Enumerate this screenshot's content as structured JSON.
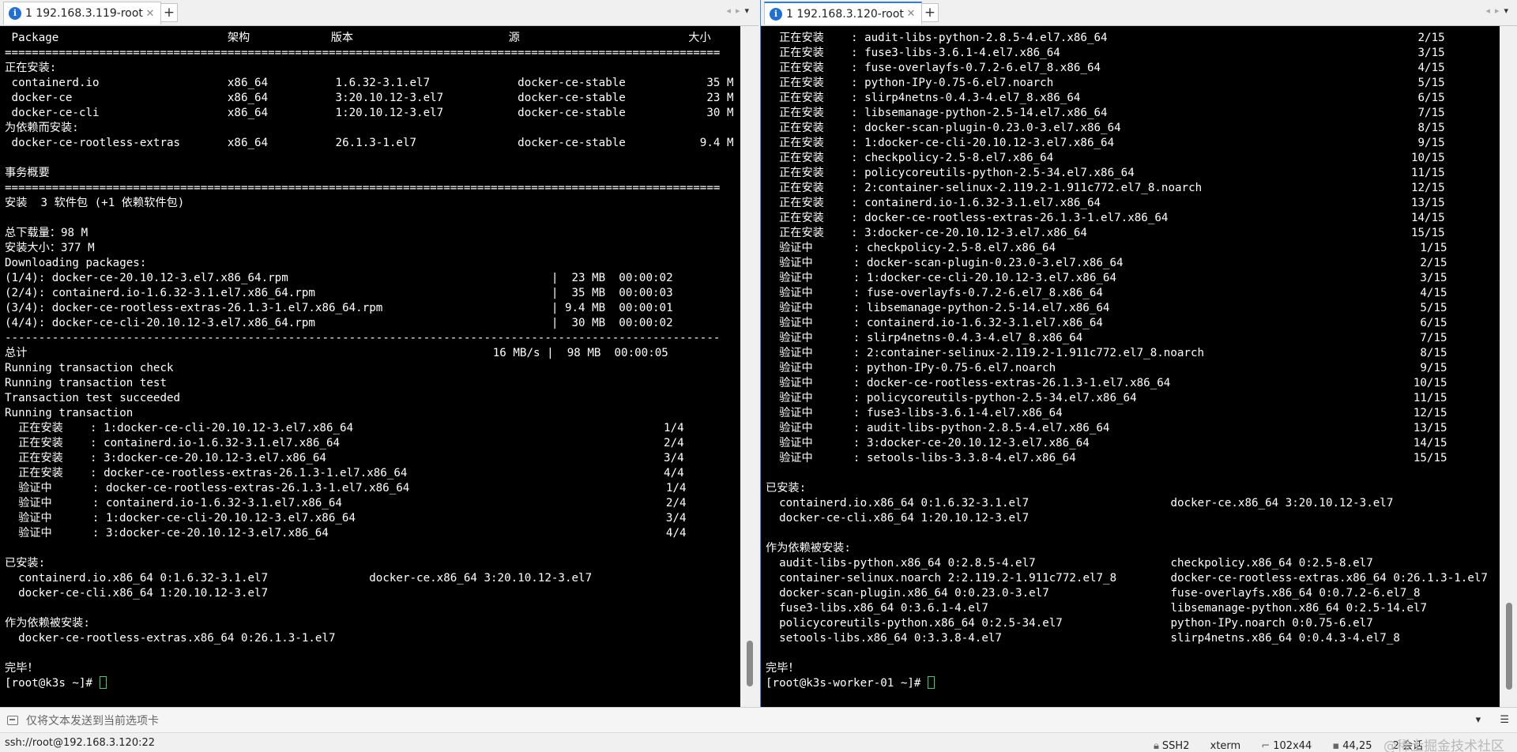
{
  "left": {
    "tab_title": "1 192.168.3.119-root",
    "lines": [
      " Package                         架构            版本                       源                         大小",
      "==========================================================================================================",
      "正在安装:",
      " containerd.io                   x86_64          1.6.32-3.1.el7             docker-ce-stable            35 M",
      " docker-ce                       x86_64          3:20.10.12-3.el7           docker-ce-stable            23 M",
      " docker-ce-cli                   x86_64          1:20.10.12-3.el7           docker-ce-stable            30 M",
      "为依赖而安装:",
      " docker-ce-rootless-extras       x86_64          26.1.3-1.el7               docker-ce-stable           9.4 M",
      "",
      "事务概要",
      "==========================================================================================================",
      "安装  3 软件包 (+1 依赖软件包)",
      "",
      "总下载量：98 M",
      "安装大小：377 M",
      "Downloading packages:",
      "(1/4): docker-ce-20.10.12-3.el7.x86_64.rpm                                       |  23 MB  00:00:02",
      "(2/4): containerd.io-1.6.32-3.1.el7.x86_64.rpm                                   |  35 MB  00:00:03",
      "(3/4): docker-ce-rootless-extras-26.1.3-1.el7.x86_64.rpm                         | 9.4 MB  00:00:01",
      "(4/4): docker-ce-cli-20.10.12-3.el7.x86_64.rpm                                   |  30 MB  00:00:02",
      "----------------------------------------------------------------------------------------------------------",
      "总计                                                                     16 MB/s |  98 MB  00:00:05",
      "Running transaction check",
      "Running transaction test",
      "Transaction test succeeded",
      "Running transaction",
      "  正在安装    : 1:docker-ce-cli-20.10.12-3.el7.x86_64                                              1/4",
      "  正在安装    : containerd.io-1.6.32-3.1.el7.x86_64                                                2/4",
      "  正在安装    : 3:docker-ce-20.10.12-3.el7.x86_64                                                  3/4",
      "  正在安装    : docker-ce-rootless-extras-26.1.3-1.el7.x86_64                                      4/4",
      "  验证中      : docker-ce-rootless-extras-26.1.3-1.el7.x86_64                                      1/4",
      "  验证中      : containerd.io-1.6.32-3.1.el7.x86_64                                                2/4",
      "  验证中      : 1:docker-ce-cli-20.10.12-3.el7.x86_64                                              3/4",
      "  验证中      : 3:docker-ce-20.10.12-3.el7.x86_64                                                  4/4",
      "",
      "已安装:",
      "  containerd.io.x86_64 0:1.6.32-3.1.el7               docker-ce.x86_64 3:20.10.12-3.el7",
      "  docker-ce-cli.x86_64 1:20.10.12-3.el7",
      "",
      "作为依赖被安装:",
      "  docker-ce-rootless-extras.x86_64 0:26.1.3-1.el7",
      "",
      "完毕！"
    ],
    "prompt": "[root@k3s ~]# "
  },
  "right": {
    "tab_title": "1 192.168.3.120-root",
    "lines": [
      "  正在安装    : audit-libs-python-2.8.5-4.el7.x86_64                                              2/15",
      "  正在安装    : fuse3-libs-3.6.1-4.el7.x86_64                                                     3/15",
      "  正在安装    : fuse-overlayfs-0.7.2-6.el7_8.x86_64                                               4/15",
      "  正在安装    : python-IPy-0.75-6.el7.noarch                                                      5/15",
      "  正在安装    : slirp4netns-0.4.3-4.el7_8.x86_64                                                  6/15",
      "  正在安装    : libsemanage-python-2.5-14.el7.x86_64                                              7/15",
      "  正在安装    : docker-scan-plugin-0.23.0-3.el7.x86_64                                            8/15",
      "  正在安装    : 1:docker-ce-cli-20.10.12-3.el7.x86_64                                             9/15",
      "  正在安装    : checkpolicy-2.5-8.el7.x86_64                                                     10/15",
      "  正在安装    : policycoreutils-python-2.5-34.el7.x86_64                                         11/15",
      "  正在安装    : 2:container-selinux-2.119.2-1.911c772.el7_8.noarch                               12/15",
      "  正在安装    : containerd.io-1.6.32-3.1.el7.x86_64                                              13/15",
      "  正在安装    : docker-ce-rootless-extras-26.1.3-1.el7.x86_64                                    14/15",
      "  正在安装    : 3:docker-ce-20.10.12-3.el7.x86_64                                                15/15",
      "  验证中      : checkpolicy-2.5-8.el7.x86_64                                                      1/15",
      "  验证中      : docker-scan-plugin-0.23.0-3.el7.x86_64                                            2/15",
      "  验证中      : 1:docker-ce-cli-20.10.12-3.el7.x86_64                                             3/15",
      "  验证中      : fuse-overlayfs-0.7.2-6.el7_8.x86_64                                               4/15",
      "  验证中      : libsemanage-python-2.5-14.el7.x86_64                                              5/15",
      "  验证中      : containerd.io-1.6.32-3.1.el7.x86_64                                               6/15",
      "  验证中      : slirp4netns-0.4.3-4.el7_8.x86_64                                                  7/15",
      "  验证中      : 2:container-selinux-2.119.2-1.911c772.el7_8.noarch                                8/15",
      "  验证中      : python-IPy-0.75-6.el7.noarch                                                      9/15",
      "  验证中      : docker-ce-rootless-extras-26.1.3-1.el7.x86_64                                    10/15",
      "  验证中      : policycoreutils-python-2.5-34.el7.x86_64                                         11/15",
      "  验证中      : fuse3-libs-3.6.1-4.el7.x86_64                                                    12/15",
      "  验证中      : audit-libs-python-2.8.5-4.el7.x86_64                                             13/15",
      "  验证中      : 3:docker-ce-20.10.12-3.el7.x86_64                                                14/15",
      "  验证中      : setools-libs-3.3.8-4.el7.x86_64                                                  15/15",
      "",
      "已安装:",
      "  containerd.io.x86_64 0:1.6.32-3.1.el7                     docker-ce.x86_64 3:20.10.12-3.el7",
      "  docker-ce-cli.x86_64 1:20.10.12-3.el7",
      "",
      "作为依赖被安装:",
      "  audit-libs-python.x86_64 0:2.8.5-4.el7                    checkpolicy.x86_64 0:2.5-8.el7",
      "  container-selinux.noarch 2:2.119.2-1.911c772.el7_8        docker-ce-rootless-extras.x86_64 0:26.1.3-1.el7",
      "  docker-scan-plugin.x86_64 0:0.23.0-3.el7                  fuse-overlayfs.x86_64 0:0.7.2-6.el7_8",
      "  fuse3-libs.x86_64 0:3.6.1-4.el7                           libsemanage-python.x86_64 0:2.5-14.el7",
      "  policycoreutils-python.x86_64 0:2.5-34.el7                python-IPy.noarch 0:0.75-6.el7",
      "  setools-libs.x86_64 0:3.3.8-4.el7                         slirp4netns.x86_64 0:0.4.3-4.el7_8",
      "",
      "完毕！"
    ],
    "prompt": "[root@k3s-worker-01 ~]# "
  },
  "send_bar": {
    "placeholder": "仅将文本发送到当前选项卡"
  },
  "status": {
    "connection": "ssh://root@192.168.3.120:22",
    "protocol": "SSH2",
    "term": "xterm",
    "size": "102x44",
    "cursor_pos": "44,25",
    "sessions": "2 会话",
    "watermark": "@稀土掘金技术社区"
  },
  "icons": {
    "tab_info": "info-icon",
    "tab_close": "close-icon",
    "new_tab": "plus-icon",
    "send": "send-text-icon",
    "menu": "hamburger-icon"
  },
  "colors": {
    "terminal_bg": "#000000",
    "terminal_fg": "#ffffff",
    "cursor": "#34d16a",
    "active_tab_accent": "#2e7dd8"
  }
}
